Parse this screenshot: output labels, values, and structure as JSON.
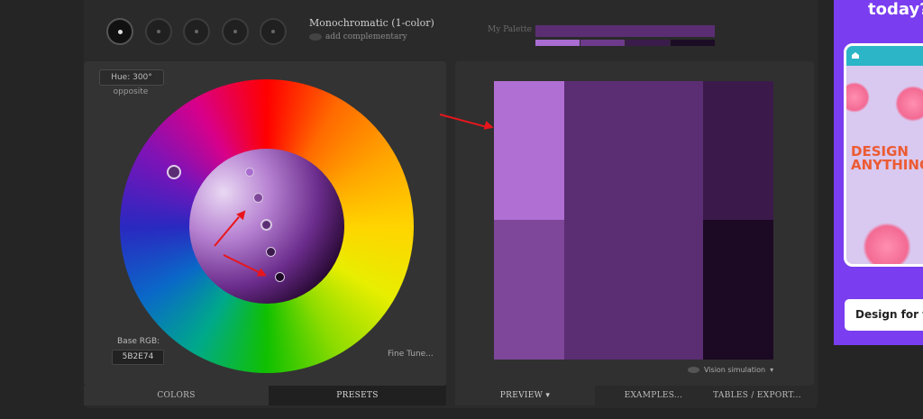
{
  "toolbar": {
    "scheme_buttons": [
      {
        "name": "mono-scheme-button",
        "active": true
      },
      {
        "name": "complement-scheme-button",
        "active": false
      },
      {
        "name": "triad-scheme-button",
        "active": false
      },
      {
        "name": "tetrad-scheme-button",
        "active": false
      },
      {
        "name": "analogic-scheme-button",
        "active": false
      }
    ],
    "scheme_name": "Monochromatic (1-color)",
    "add_complementary": "add complementary"
  },
  "palette": {
    "label": "My Palette",
    "base_color": "#5B2E74",
    "swatches": [
      "#A96CD0",
      "#6E3B8C",
      "#3A1B4B",
      "#1D0C26"
    ]
  },
  "wheel": {
    "hue_label": "Hue: 300°",
    "mode_label": "opposite",
    "base_rgb_label": "Base RGB:",
    "base_rgb_value": "5B2E74",
    "fine_tune": "Fine Tune..."
  },
  "left_tabs": {
    "colors": "COLORS",
    "presets": "PRESETS"
  },
  "preview_colors": {
    "light": "#B06FD2",
    "light_mid": "#7E479A",
    "base": "#5B2E74",
    "dark": "#3B1A4B",
    "darkest": "#1C0924"
  },
  "vision_simulation": "Vision simulation",
  "right_tabs": {
    "preview": "PREVIEW",
    "examples": "EXAMPLES...",
    "tables": "TABLES / EXPORT..."
  },
  "ad": {
    "title": "today?",
    "headline": "DESIGN ANYTHING",
    "cta": "Design for free"
  },
  "colors": {
    "annotation_arrow": "#E8161C",
    "ad_background": "#7A3DF0"
  }
}
